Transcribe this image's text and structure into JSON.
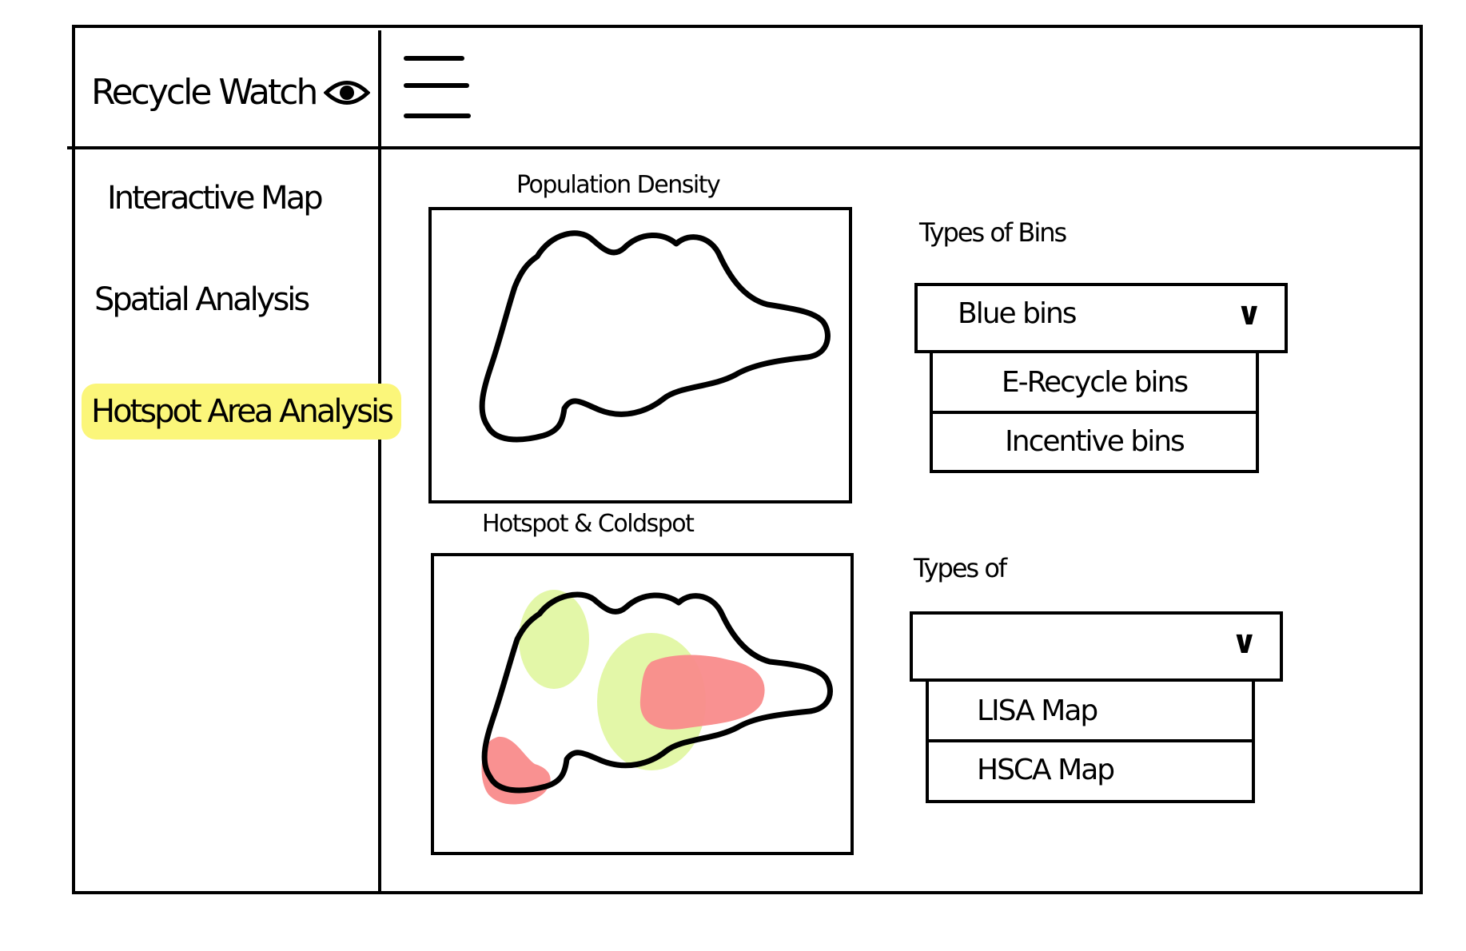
{
  "header": {
    "brand": "Recycle Watch",
    "brand_icon": "eye-icon",
    "menu_icon": "hamburger-menu-icon"
  },
  "sidebar": {
    "items": [
      {
        "label": "Interactive Map",
        "active": false
      },
      {
        "label": "Spatial Analysis",
        "active": false
      },
      {
        "label": "Hotspot Area Analysis",
        "active": true
      }
    ],
    "active_color": "#fbf67a"
  },
  "main": {
    "population_panel": {
      "title": "Population Density"
    },
    "hotspot_panel": {
      "title": "Hotspot & Coldspot",
      "hot_color": "#f98b8b",
      "cold_color": "#e3f7a8"
    },
    "bins_control": {
      "label": "Types of Bins",
      "selected": "Blue bins",
      "chevron": "chevron-down-icon",
      "options": [
        "E-Recycle bins",
        "Incentive bins"
      ]
    },
    "map_type_control": {
      "label": "Types of",
      "selected": "",
      "chevron": "chevron-down-icon",
      "options": [
        "LISA Map",
        "HSCA Map"
      ]
    }
  }
}
